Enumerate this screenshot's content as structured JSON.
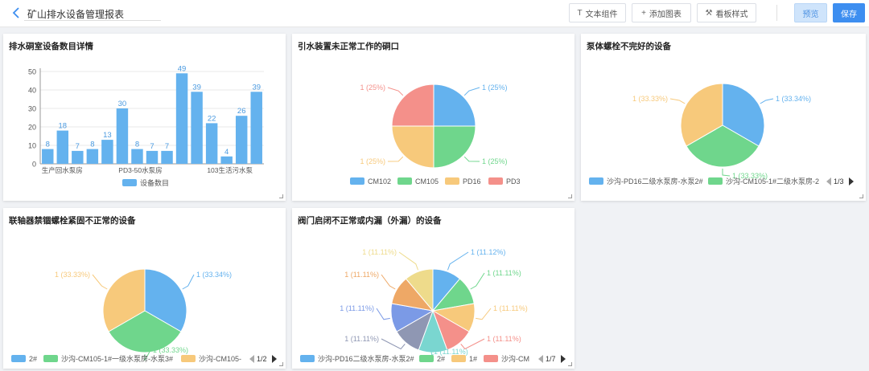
{
  "header": {
    "title": "矿山排水设备管理报表",
    "buttons": [
      {
        "label": "文本组件",
        "icon": "T"
      },
      {
        "label": "添加图表",
        "icon": "+"
      },
      {
        "label": "看板样式",
        "icon": "⚒"
      }
    ],
    "preview_label": "预览",
    "save_label": "保存"
  },
  "panels": [
    {
      "title": "排水硐室设备数目详情"
    },
    {
      "title": "引水装置未正常工作的硐口"
    },
    {
      "title": "泵体螺栓不完好的设备"
    },
    {
      "title": "联轴器禁锢螺栓紧固不正常的设备"
    },
    {
      "title": "阀门启闭不正常或内漏（外漏）的设备"
    }
  ],
  "colors": {
    "blue": "#64b2ee",
    "green": "#6fd68c",
    "yellow": "#f7c97b",
    "red": "#f4908a",
    "purple": "#7b9ae6",
    "gray": "#8f97b3",
    "teal": "#7ad6d0",
    "orange": "#eea866",
    "khaki": "#eedb8b"
  },
  "chart_data": [
    {
      "type": "bar",
      "title": "排水硐室设备数目详情",
      "tick_labels": [
        "生产回水泵房",
        "PD3-50水泵房",
        "103生活污水泵"
      ],
      "values": [
        8,
        18,
        7,
        8,
        13,
        30,
        8,
        7,
        7,
        49,
        39,
        22,
        4,
        26,
        39
      ],
      "ylim": [
        0,
        50
      ],
      "yticks": [
        0,
        10,
        20,
        30,
        40,
        50
      ],
      "series": [
        {
          "name": "设备数目",
          "values": [
            8,
            18,
            7,
            8,
            13,
            30,
            8,
            7,
            7,
            49,
            39,
            22,
            4,
            26,
            39
          ]
        }
      ],
      "legend": "bottom",
      "color": "#64b2ee"
    },
    {
      "type": "pie",
      "title": "引水装置未正常工作的硐口",
      "slices": [
        {
          "label": "CM102",
          "value": 1,
          "text": "1 (25%)",
          "color": "#64b2ee"
        },
        {
          "label": "CM105",
          "value": 1,
          "text": "1 (25%)",
          "color": "#6fd68c"
        },
        {
          "label": "PD16",
          "value": 1,
          "text": "1 (25%)",
          "color": "#f7c97b"
        },
        {
          "label": "PD3",
          "value": 1,
          "text": "1 (25%)",
          "color": "#f4908a"
        }
      ],
      "legend": "bottom"
    },
    {
      "type": "pie",
      "title": "泵体螺栓不完好的设备",
      "slices": [
        {
          "label": "沙沟-PD16二级水泵房-水泵2#",
          "value": 1,
          "text": "1 (33.34%)",
          "color": "#64b2ee"
        },
        {
          "label": "沙沟-CM105-1#二级水泵房-2",
          "value": 1,
          "text": "1 (33.33%)",
          "color": "#6fd68c"
        },
        {
          "label": "",
          "value": 1,
          "text": "1 (33.33%)",
          "color": "#f7c97b"
        }
      ],
      "legend": "bottom",
      "legend_page": "1/3"
    },
    {
      "type": "pie",
      "title": "联轴器禁锢螺栓紧固不正常的设备",
      "slices": [
        {
          "label": "2#",
          "value": 1,
          "text": "1 (33.34%)",
          "color": "#64b2ee"
        },
        {
          "label": "沙沟-CM105-1#一级水泵房-水泵3#",
          "value": 1,
          "text": "1 (33.33%)",
          "color": "#6fd68c"
        },
        {
          "label": "沙沟-CM105-",
          "value": 1,
          "text": "1 (33.33%)",
          "color": "#f7c97b"
        }
      ],
      "legend": "bottom",
      "legend_page": "1/2"
    },
    {
      "type": "pie",
      "title": "阀门启闭不正常或内漏（外漏）的设备",
      "slices": [
        {
          "label": "沙沟-PD16二级水泵房-水泵2#",
          "value": 1,
          "text": "1 (11.12%)",
          "color": "#64b2ee"
        },
        {
          "label": "2#",
          "value": 1,
          "text": "1 (11.11%)",
          "color": "#6fd68c"
        },
        {
          "label": "1#",
          "value": 1,
          "text": "1 (11.11%)",
          "color": "#f7c97b"
        },
        {
          "label": "沙沟-CM",
          "value": 1,
          "text": "1 (11.11%)",
          "color": "#f4908a"
        },
        {
          "label": "",
          "value": 1,
          "text": "1 (11.11%)",
          "color": "#7ad6d0"
        },
        {
          "label": "",
          "value": 1,
          "text": "1 (11.11%)",
          "color": "#8f97b3"
        },
        {
          "label": "",
          "value": 1,
          "text": "1 (11.11%)",
          "color": "#7b9ae6"
        },
        {
          "label": "",
          "value": 1,
          "text": "1 (11.11%)",
          "color": "#eea866"
        },
        {
          "label": "",
          "value": 1,
          "text": "1 (11.11%)",
          "color": "#eedb8b"
        }
      ],
      "legend": "bottom",
      "legend_page": "1/7"
    }
  ]
}
